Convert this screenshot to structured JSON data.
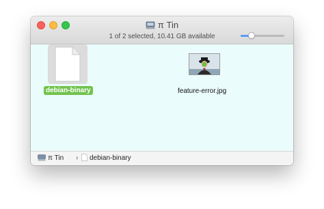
{
  "window": {
    "title": "π Tin",
    "title_icon": "external-disk-icon",
    "traffic_lights": [
      "close",
      "minimize",
      "zoom"
    ]
  },
  "status": {
    "text": "1 of 2 selected, 10.41 GB available",
    "icon_size_slider": 0.25
  },
  "files": [
    {
      "name": "debian-binary",
      "icon": "generic-document-icon",
      "selected": true
    },
    {
      "name": "feature-error.jpg",
      "icon": "image-thumbnail",
      "selected": false
    }
  ],
  "path_bar": {
    "items": [
      {
        "label": "π Tin",
        "icon": "external-disk-icon"
      },
      {
        "label": "debian-binary",
        "icon": "document-icon"
      }
    ],
    "separator": "›"
  },
  "colors": {
    "content_bg": "#eafcfb",
    "selection_label": "#71c24d",
    "close": "#fc605c",
    "minimize": "#fdbc40",
    "zoom": "#34c84a",
    "slider_accent": "#5b9bf6"
  }
}
